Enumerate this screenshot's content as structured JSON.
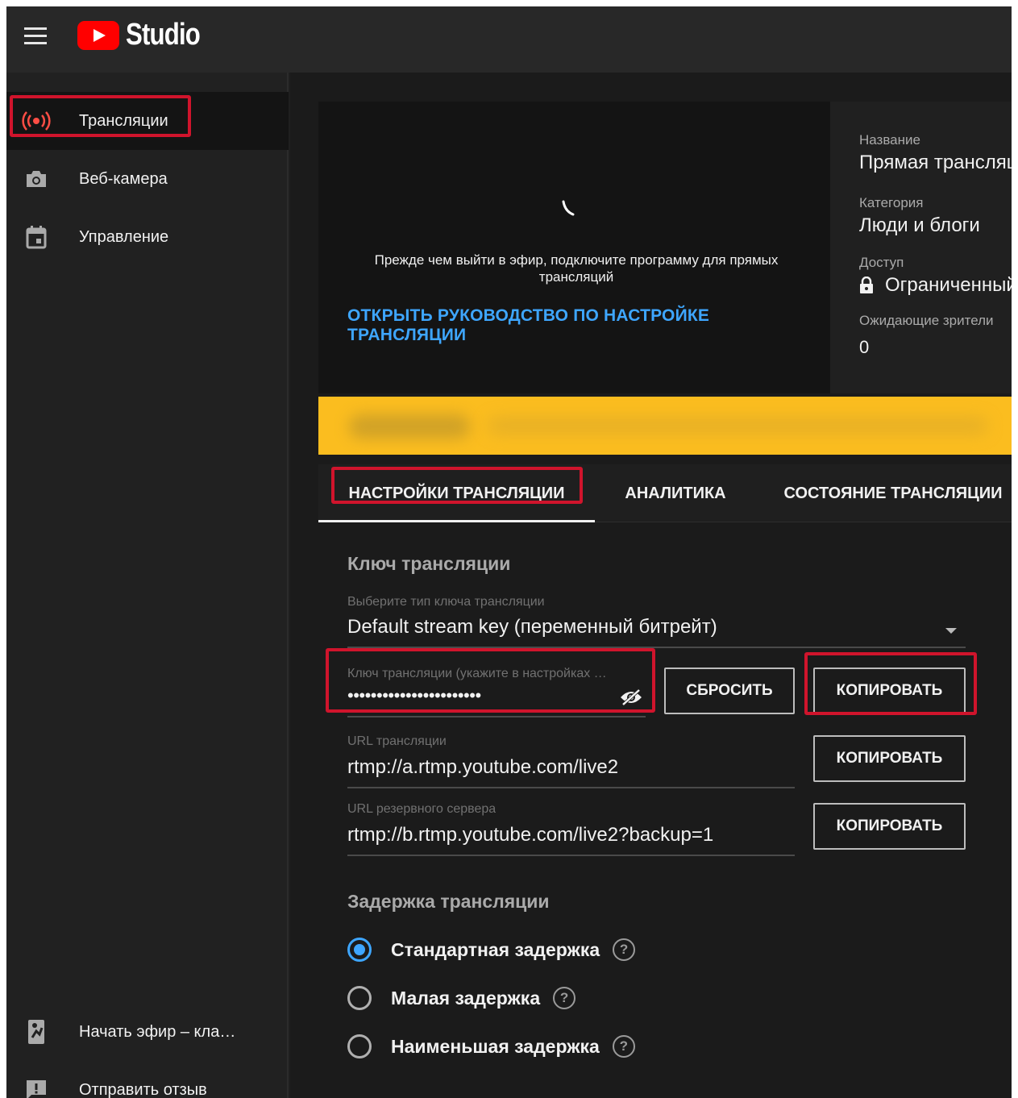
{
  "app": {
    "logo_text": "Studio"
  },
  "colors": {
    "accent": "#3ea6ff",
    "brand_red": "#ff0000",
    "highlight": "#d0142c",
    "banner": "#fbbd1f"
  },
  "sidebar": {
    "items": [
      {
        "label": "Трансляции",
        "icon": "live-broadcast-icon"
      },
      {
        "label": "Веб-камера",
        "icon": "camera-icon"
      },
      {
        "label": "Управление",
        "icon": "calendar-icon"
      }
    ],
    "bottom": [
      {
        "label": "Начать эфир – кла…",
        "icon": "go-live-icon"
      },
      {
        "label": "Отправить отзыв",
        "icon": "feedback-icon"
      }
    ]
  },
  "preview": {
    "message": "Прежде чем выйти в эфир, подключите программу для прямых трансляций",
    "guide_link": "ОТКРЫТЬ РУКОВОДСТВО ПО НАСТРОЙКЕ ТРАНСЛЯЦИИ"
  },
  "info": {
    "title_label": "Название",
    "title_value": "Прямая трансляция",
    "category_label": "Категория",
    "category_value": "Люди и блоги",
    "access_label": "Доступ",
    "access_value": "Ограниченный доступ",
    "waiting_label": "Ожидающие зрители",
    "waiting_value": "0"
  },
  "tabs": [
    {
      "label": "НАСТРОЙКИ ТРАНСЛЯЦИИ",
      "selected": true
    },
    {
      "label": "АНАЛИТИКА",
      "selected": false
    },
    {
      "label": "СОСТОЯНИЕ ТРАНСЛЯЦИИ",
      "selected": false
    }
  ],
  "stream_key": {
    "section_title": "Ключ трансляции",
    "type_label": "Выберите тип ключа трансляции",
    "type_value": "Default stream key (переменный битрейт)",
    "key_label": "Ключ трансляции (укажите в настройках …",
    "key_value": "•••••••••••••••••••••••",
    "reset_button": "СБРОСИТЬ",
    "copy_button": "КОПИРОВАТЬ",
    "url_label": "URL трансляции",
    "url_value": "rtmp://a.rtmp.youtube.com/live2",
    "backup_label": "URL резервного сервера",
    "backup_value": "rtmp://b.rtmp.youtube.com/live2?backup=1"
  },
  "latency": {
    "section_title": "Задержка трансляции",
    "options": [
      {
        "label": "Стандартная задержка",
        "checked": true
      },
      {
        "label": "Малая задержка",
        "checked": false
      },
      {
        "label": "Наименьшая задержка",
        "checked": false
      }
    ],
    "help_glyph": "?"
  }
}
